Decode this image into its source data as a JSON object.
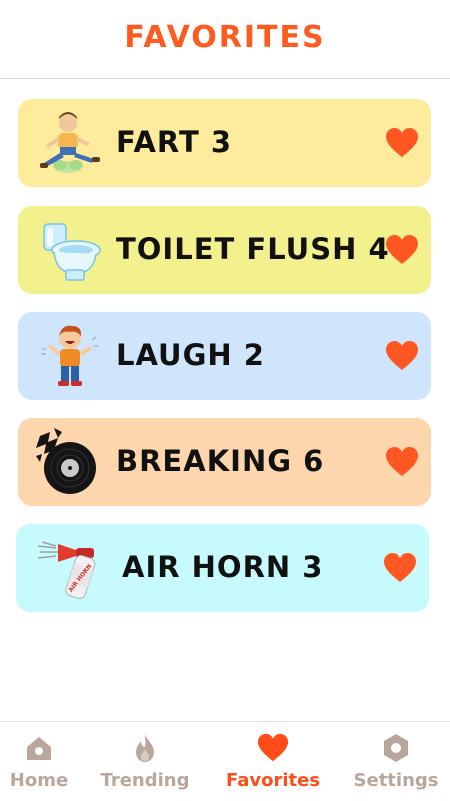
{
  "header": {
    "title": "FAVORITES"
  },
  "colors": {
    "accent": "#ff5a1f",
    "heart": "#ff5722",
    "nav_inactive": "#b9a79c",
    "nav_active": "#ff4d1a"
  },
  "favorites": [
    {
      "label": "FART 3",
      "icon": "fart-cartoon-icon",
      "bg": "#feeb9c",
      "favorited": true
    },
    {
      "label": "TOILET FLUSH 4",
      "icon": "toilet-icon",
      "bg": "#f3f08e",
      "favorited": true
    },
    {
      "label": "LAUGH 2",
      "icon": "laughing-boy-icon",
      "bg": "#cfe5fb",
      "favorited": true
    },
    {
      "label": "BREAKING 6",
      "icon": "broken-record-icon",
      "bg": "#fdd6ad",
      "favorited": true
    },
    {
      "label": "AIR HORN 3",
      "icon": "air-horn-icon",
      "bg": "#c7fafd",
      "favorited": true
    }
  ],
  "air_horn_can_text": "AIR HORN",
  "nav": [
    {
      "label": "Home",
      "icon": "home-icon",
      "active": false
    },
    {
      "label": "Trending",
      "icon": "fire-icon",
      "active": false
    },
    {
      "label": "Favorites",
      "icon": "heart-icon",
      "active": true
    },
    {
      "label": "Settings",
      "icon": "gear-icon",
      "active": false
    }
  ]
}
